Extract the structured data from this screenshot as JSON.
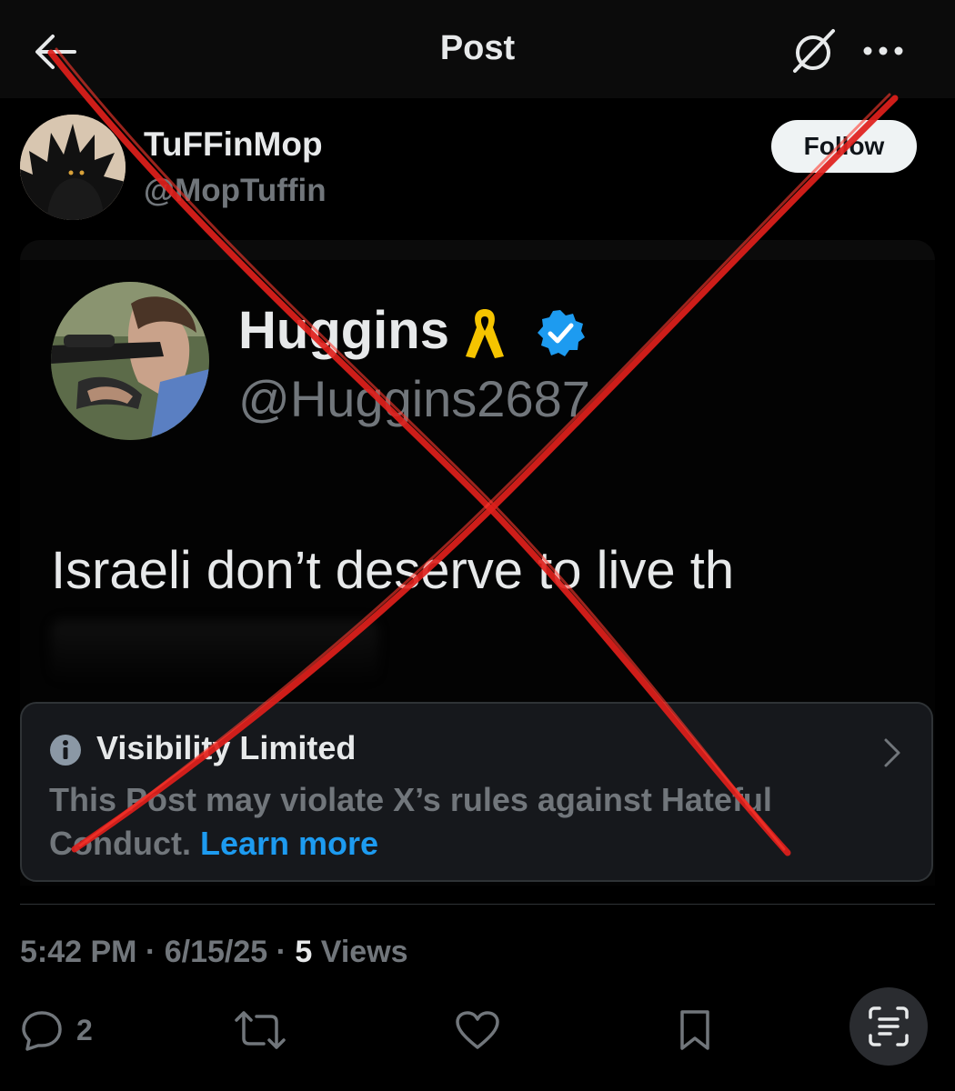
{
  "header": {
    "title": "Post",
    "back_icon": "arrow-left-icon",
    "grok_icon": "grok-icon",
    "more_icon": "more-horizontal-icon"
  },
  "author": {
    "name": "TuFFinMop",
    "handle": "@MopTuffin",
    "follow_label": "Follow"
  },
  "quoted": {
    "name": "Huggins",
    "ribbon_icon": "yellow-ribbon-icon",
    "verified_icon": "verified-badge-icon",
    "handle": "@Huggins2687",
    "text": "Israeli don’t deserve to live th"
  },
  "notice": {
    "title": "Visibility Limited",
    "body": "This Post may violate X’s rules against Hateful Conduct.",
    "link": "Learn more"
  },
  "meta": {
    "time": "5:42 PM",
    "date": "6/15/25",
    "views_count": "5",
    "views_label": "Views"
  },
  "actions": {
    "reply_count": "2"
  },
  "colors": {
    "background": "#000000",
    "link": "#1d9bf0",
    "verified": "#1d9bf0",
    "ribbon": "#f5c400",
    "overlay_x": "#e0201b"
  }
}
